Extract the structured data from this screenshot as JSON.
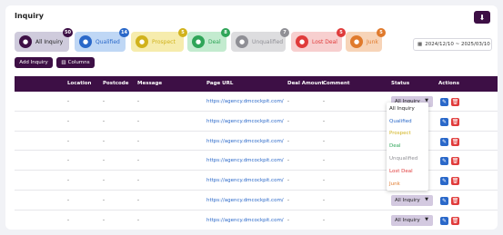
{
  "header": {
    "title": "Inquiry",
    "download_icon": "download-icon"
  },
  "filters": [
    {
      "label": "All Inquiry",
      "count": "50",
      "icon": "person-icon",
      "bg": "#cfcbdc",
      "icon_bg": "#3d0f45",
      "badge_bg": "#3d0f45"
    },
    {
      "label": "Qualified",
      "count": "14",
      "icon": "badge-icon",
      "bg": "#bfd7f5",
      "icon_bg": "#2a68c9",
      "badge_bg": "#2a68c9"
    },
    {
      "label": "Prospect",
      "count": "5",
      "icon": "search-icon",
      "bg": "#f6ecad",
      "icon_bg": "#d1b21c",
      "badge_bg": "#d1b21c"
    },
    {
      "label": "Deal",
      "count": "8",
      "icon": "handshake-icon",
      "bg": "#c3ebcf",
      "icon_bg": "#2fa558",
      "badge_bg": "#2fa558"
    },
    {
      "label": "Unqualified",
      "count": "7",
      "icon": "thumbs-down-icon",
      "bg": "#dddddf",
      "icon_bg": "#8f8f95",
      "badge_bg": "#8f8f95"
    },
    {
      "label": "Lost Deal",
      "count": "5",
      "icon": "lost-icon",
      "bg": "#f7cfcf",
      "icon_bg": "#e03b3b",
      "badge_bg": "#e03b3b"
    },
    {
      "label": "Junk",
      "count": "5",
      "icon": "trash-icon",
      "bg": "#f7d4b8",
      "icon_bg": "#e07a2c",
      "badge_bg": "#e07a2c"
    }
  ],
  "date_range": "2024/12/10 ~ 2025/03/10",
  "buttons": {
    "add_inquiry": "Add Inquiry",
    "columns": "Columns"
  },
  "table": {
    "headers": [
      "Location",
      "Postcode",
      "Message",
      "Page URL",
      "Deal Amount",
      "Comment",
      "Status",
      "Actions"
    ],
    "rows": [
      {
        "location": "-",
        "postcode": "-",
        "message": "-",
        "url": "https://agency.dmcockpit.com/",
        "deal": "-",
        "comment": "-",
        "status": "All Inquiry"
      },
      {
        "location": "-",
        "postcode": "-",
        "message": "-",
        "url": "https://agency.dmcockpit.com/",
        "deal": "-",
        "comment": "-",
        "status": ""
      },
      {
        "location": "-",
        "postcode": "-",
        "message": "-",
        "url": "https://agency.dmcockpit.com/",
        "deal": "-",
        "comment": "-",
        "status": ""
      },
      {
        "location": "-",
        "postcode": "-",
        "message": "-",
        "url": "https://agency.dmcockpit.com/",
        "deal": "-",
        "comment": "-",
        "status": ""
      },
      {
        "location": "-",
        "postcode": "-",
        "message": "-",
        "url": "https://agency.dmcockpit.com/",
        "deal": "-",
        "comment": "-",
        "status": ""
      },
      {
        "location": "-",
        "postcode": "-",
        "message": "-",
        "url": "https://agency.dmcockpit.com/",
        "deal": "-",
        "comment": "-",
        "status": "All Inquiry"
      },
      {
        "location": "-",
        "postcode": "-",
        "message": "-",
        "url": "https://agency.dmcockpit.com/",
        "deal": "-",
        "comment": "-",
        "status": "All Inquiry"
      }
    ]
  },
  "status_options": [
    {
      "label": "All Inquiry",
      "color": "#222222"
    },
    {
      "label": "Qualified",
      "color": "#2a68c9"
    },
    {
      "label": "Prospect",
      "color": "#d1b21c"
    },
    {
      "label": "Deal",
      "color": "#2fa558"
    },
    {
      "label": "Unqualified",
      "color": "#8f8f95"
    },
    {
      "label": "Lost Deal",
      "color": "#e03b3b"
    },
    {
      "label": "Junk",
      "color": "#e07a2c"
    }
  ]
}
